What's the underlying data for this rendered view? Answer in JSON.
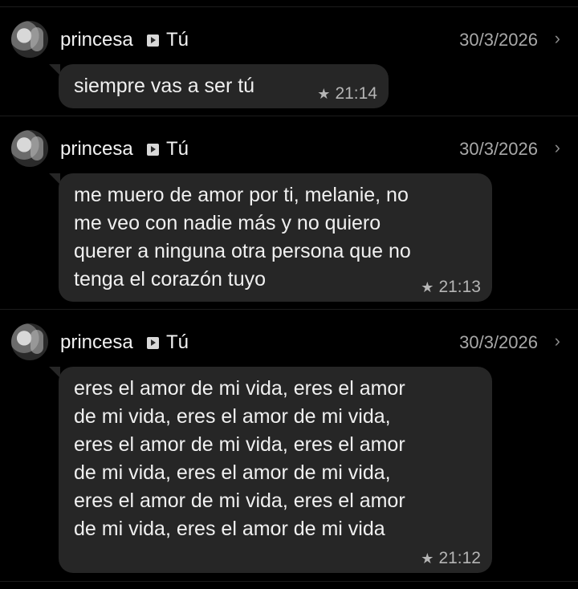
{
  "messages": [
    {
      "sender": "princesa",
      "recipient": "Tú",
      "date": "30/3/2026",
      "text": "siempre vas a ser tú",
      "time": "21:14"
    },
    {
      "sender": "princesa",
      "recipient": "Tú",
      "date": "30/3/2026",
      "text": "me muero de amor por ti, melanie, no\nme veo con nadie más y no quiero\nquerer a ninguna otra persona que no\ntenga el corazón tuyo",
      "time": "21:13"
    },
    {
      "sender": "princesa",
      "recipient": "Tú",
      "date": "30/3/2026",
      "text": "eres el amor de mi vida, eres el amor\nde mi vida, eres el amor de mi vida,\neres el amor de mi vida, eres el amor\nde mi vida, eres el amor de mi vida,\neres el amor de mi vida, eres el amor\nde mi vida, eres el amor de mi vida",
      "time": "21:12"
    }
  ],
  "icons": {
    "direction": "play-arrow-icon",
    "star": "star-icon",
    "open": "chevron-right-icon"
  },
  "colors": {
    "background": "#000000",
    "bubble": "#262626",
    "text": "#f0f0f0",
    "muted": "#a8a8a8"
  }
}
